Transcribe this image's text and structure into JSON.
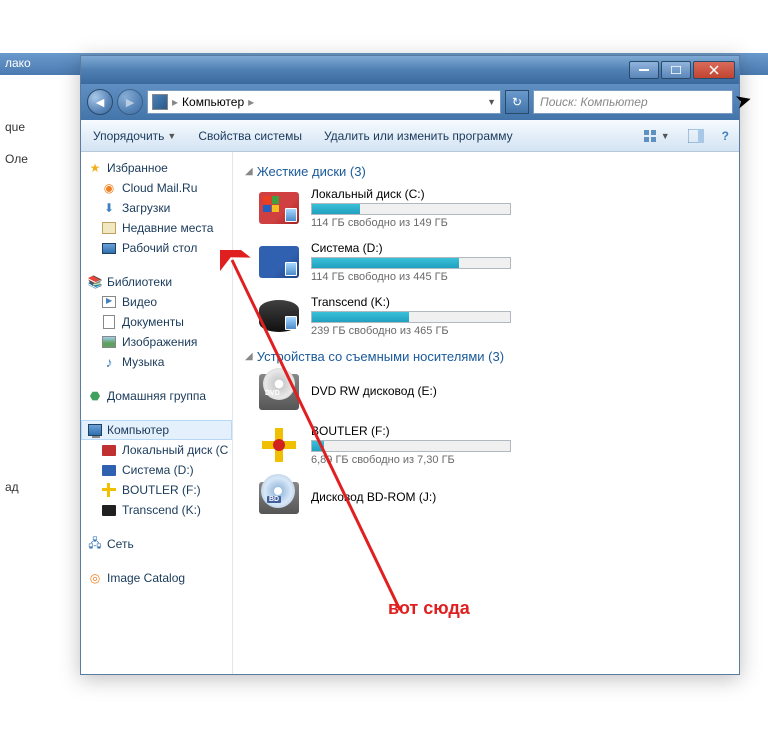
{
  "background": {
    "text1": "лако",
    "text2": "que",
    "text3": "Оле",
    "text4": "ад"
  },
  "titlebar": {},
  "address": {
    "separator": "▸",
    "location": "Компьютер"
  },
  "search_placeholder": "Поиск: Компьютер",
  "toolbar": {
    "organize": "Упорядочить",
    "system_props": "Свойства системы",
    "uninstall": "Удалить или изменить программу"
  },
  "sidebar": {
    "favorites": {
      "header": "Избранное",
      "items": [
        {
          "label": "Cloud Mail.Ru"
        },
        {
          "label": "Загрузки"
        },
        {
          "label": "Недавние места"
        },
        {
          "label": "Рабочий стол"
        }
      ]
    },
    "libraries": {
      "header": "Библиотеки",
      "items": [
        {
          "label": "Видео"
        },
        {
          "label": "Документы"
        },
        {
          "label": "Изображения"
        },
        {
          "label": "Музыка"
        }
      ]
    },
    "homegroup": {
      "header": "Домашняя группа"
    },
    "computer": {
      "header": "Компьютер",
      "items": [
        {
          "label": "Локальный диск (C"
        },
        {
          "label": "Система (D:)"
        },
        {
          "label": "BOUTLER (F:)"
        },
        {
          "label": "Transcend (K:)"
        }
      ]
    },
    "network": {
      "header": "Сеть"
    },
    "imagecatalog": {
      "header": "Image Catalog"
    }
  },
  "content": {
    "section1": {
      "title": "Жесткие диски (3)",
      "drives": [
        {
          "name": "Локальный диск (C:)",
          "free": "114 ГБ свободно из 149 ГБ",
          "fill": 24
        },
        {
          "name": "Система (D:)",
          "free": "114 ГБ свободно из 445 ГБ",
          "fill": 74
        },
        {
          "name": "Transcend (K:)",
          "free": "239 ГБ свободно из 465 ГБ",
          "fill": 49
        }
      ]
    },
    "section2": {
      "title": "Устройства со съемными носителями (3)",
      "drives": [
        {
          "name": "DVD RW дисковод (E:)"
        },
        {
          "name": "BOUTLER (F:)",
          "free": "6,89 ГБ свободно из 7,30 ГБ",
          "fill": 6
        },
        {
          "name": "Дисковод BD-ROM (J:)"
        }
      ]
    }
  },
  "annotation": "вот сюда"
}
